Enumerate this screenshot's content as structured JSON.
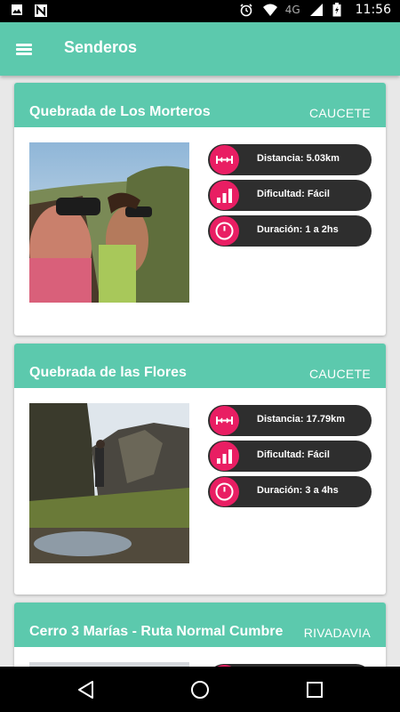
{
  "status_bar": {
    "icons_left": [
      "image-icon",
      "n-notification-icon"
    ],
    "icons_right": [
      "alarm-icon",
      "wifi-icon",
      "signal-icon",
      "battery-icon"
    ],
    "network": "4G",
    "time": "11:56"
  },
  "app_bar": {
    "title": "Senderos",
    "menu_icon": "menu-icon"
  },
  "colors": {
    "accent": "#5cc9ad",
    "badge": "#e91e63",
    "pill": "#2e2e2e"
  },
  "trails": [
    {
      "title": "Quebrada de Los Morteros",
      "location": "CAUCETE",
      "distance": "Distancia: 5.03km",
      "difficulty": "Dificultad: Fácil",
      "duration": "Duración: 1 a 2hs"
    },
    {
      "title": "Quebrada de las Flores",
      "location": "CAUCETE",
      "distance": "Distancia: 17.79km",
      "difficulty": "Dificultad: Fácil",
      "duration": "Duración: 3 a 4hs"
    },
    {
      "title": "Cerro 3 Marías - Ruta Normal Cumbre",
      "location": "RIVADAVIA"
    }
  ],
  "nav_bar": {
    "icons": [
      "back-icon",
      "home-icon",
      "recents-icon"
    ]
  }
}
